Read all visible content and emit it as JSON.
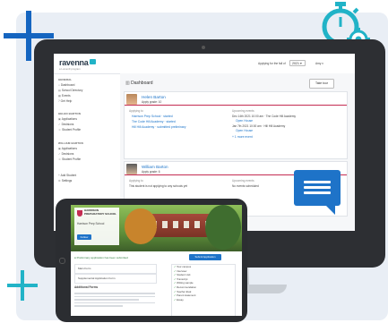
{
  "app": {
    "logo": "ravenna",
    "logo_sub": "a Lumen9 program"
  },
  "header": {
    "applying_label": "Applying for the fall of",
    "year": "2021",
    "user": "Amy"
  },
  "sidebar": {
    "general_title": "GENERAL",
    "general_items": [
      "Dashboard",
      "School Directory",
      "Events",
      "Get Help"
    ],
    "helen_title": "HELEN BARTON",
    "helen_items": [
      "Applications",
      "Decisions",
      "Student Profile"
    ],
    "william_title": "WILLIAM BARTON",
    "william_items": [
      "Applications",
      "Decisions",
      "Student Profile"
    ],
    "bottom_items": [
      "Add Student",
      "Settings"
    ]
  },
  "main": {
    "title": "Dashboard",
    "take_tour": "Take tour",
    "helen": {
      "name": "Helen Barton",
      "grade": "Apply grade: 10",
      "applying_label": "Applying to",
      "schools": [
        "Harrison Prep School · started",
        "The Code Hill Academy · started",
        "Hill Hill Academy · submitted preliminary"
      ],
      "upcoming_label": "Upcoming events",
      "events": [
        "Dec 14th 2021 10:00 am · The Code Hill Academy",
        "Open House",
        "Jan 7th 2021 10:00 am · Hill Hill Academy",
        "Open House"
      ],
      "more": "+ 1 more event"
    },
    "william": {
      "name": "William Barton",
      "grade": "Apply grade: 6",
      "applying_label": "Applying to",
      "applying_text": "This student is not applying to any schools yet",
      "upcoming_label": "Upcoming events",
      "upcoming_text": "No events scheduled"
    }
  },
  "tablet": {
    "school_name": "HARRISON PREPARATORY SCHOOL",
    "school_title": "Harrison Prep School",
    "follow_button": "Follow",
    "apply_banner": "Preliminary application has been submitted",
    "submit_button": "Submit Application",
    "forms": [
      "Main Form",
      "Supplemental Application Form"
    ],
    "additional_forms": "Additional Forms",
    "checklist": [
      "Tour campus",
      "Interview",
      "Student visit",
      "Transcript",
      "Writing sample",
      "Recommendation",
      "Teacher Eval",
      "Parent statement",
      "Essay"
    ]
  },
  "colors": {
    "accent": "#1e73c8",
    "brand": "#c42c52",
    "teal": "#21b3c7"
  },
  "icons": [
    "plus-icon",
    "stopwatch-gear-icon",
    "chat-bubble-icon",
    "home-icon",
    "directory-icon",
    "calendar-icon",
    "help-icon",
    "applications-icon",
    "decisions-icon",
    "profile-icon"
  ]
}
